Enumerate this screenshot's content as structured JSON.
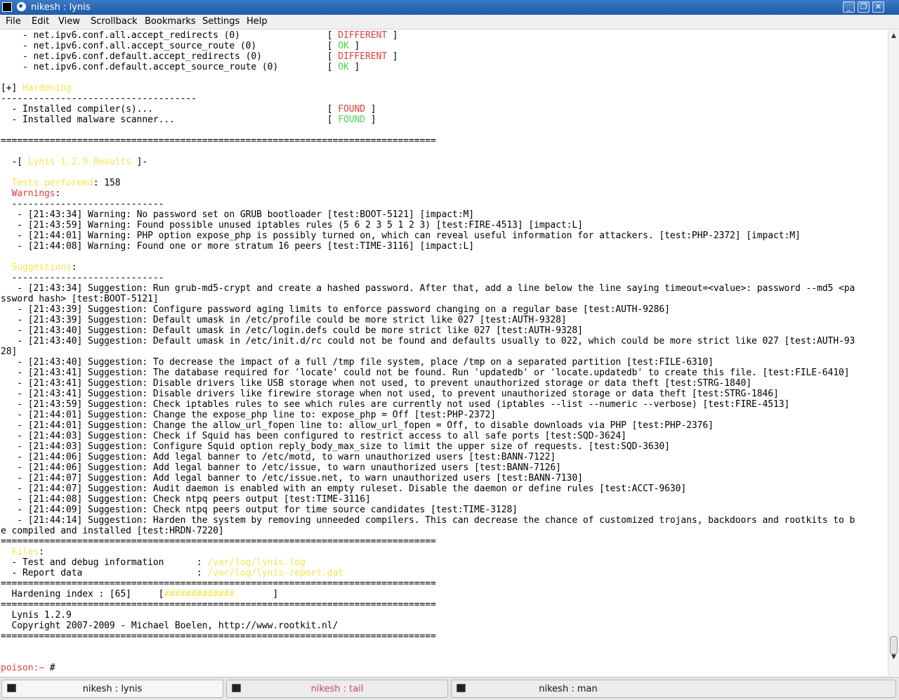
{
  "window": {
    "title": "nikesh : lynis",
    "buttons": [
      "_",
      "❐",
      "✕"
    ]
  },
  "menu": [
    "File",
    "Edit",
    "View",
    "Scrollback",
    "Bookmarks",
    "Settings",
    "Help"
  ],
  "terminal": {
    "lines": [
      [
        {
          "t": "    - net.ipv6.conf.all.accept_redirects (0)                [ "
        },
        {
          "t": "DIFFERENT",
          "c": "red"
        },
        {
          "t": " ]"
        }
      ],
      [
        {
          "t": "    - net.ipv6.conf.all.accept_source_route (0)             [ "
        },
        {
          "t": "OK",
          "c": "green"
        },
        {
          "t": " ]"
        }
      ],
      [
        {
          "t": "    - net.ipv6.conf.default.accept_redirects (0)            [ "
        },
        {
          "t": "DIFFERENT",
          "c": "red"
        },
        {
          "t": " ]"
        }
      ],
      [
        {
          "t": "    - net.ipv6.conf.default.accept_source_route (0)         [ "
        },
        {
          "t": "OK",
          "c": "green"
        },
        {
          "t": " ]"
        }
      ],
      [
        {
          "t": ""
        }
      ],
      [
        {
          "t": "[+] "
        },
        {
          "t": "Hardening",
          "c": "yellow"
        }
      ],
      [
        {
          "t": "------------------------------------"
        }
      ],
      [
        {
          "t": "  - Installed compiler(s)...                                [ "
        },
        {
          "t": "FOUND",
          "c": "red"
        },
        {
          "t": " ]"
        }
      ],
      [
        {
          "t": "  - Installed malware scanner...                            [ "
        },
        {
          "t": "FOUND",
          "c": "green"
        },
        {
          "t": " ]"
        }
      ],
      [
        {
          "t": ""
        }
      ],
      [
        {
          "t": "================================================================================"
        }
      ],
      [
        {
          "t": ""
        }
      ],
      [
        {
          "t": "  -[ "
        },
        {
          "t": "Lynis 1.2.9 Results",
          "c": "yellow"
        },
        {
          "t": " ]-"
        }
      ],
      [
        {
          "t": ""
        }
      ],
      [
        {
          "t": "  "
        },
        {
          "t": "Tests performed",
          "c": "yellow"
        },
        {
          "t": ": 158"
        }
      ],
      [
        {
          "t": "  "
        },
        {
          "t": "Warnings",
          "c": "red"
        },
        {
          "t": ":"
        }
      ],
      [
        {
          "t": "  ----------------------------"
        }
      ],
      [
        {
          "t": "   - [21:43:34] Warning: No password set on GRUB bootloader [test:BOOT-5121] [impact:M]"
        }
      ],
      [
        {
          "t": "   - [21:43:59] Warning: Found possible unused iptables rules (5 6 2 3 5 1 2 3) [test:FIRE-4513] [impact:L]"
        }
      ],
      [
        {
          "t": "   - [21:44:01] Warning: PHP option expose_php is possibly turned on, which can reveal useful information for attackers. [test:PHP-2372] [impact:M]"
        }
      ],
      [
        {
          "t": "   - [21:44:08] Warning: Found one or more stratum 16 peers [test:TIME-3116] [impact:L]"
        }
      ],
      [
        {
          "t": ""
        }
      ],
      [
        {
          "t": "  "
        },
        {
          "t": "Suggestions",
          "c": "yellow"
        },
        {
          "t": ":"
        }
      ],
      [
        {
          "t": "  ----------------------------"
        }
      ],
      [
        {
          "t": "   - [21:43:34] Suggestion: Run grub-md5-crypt and create a hashed password. After that, add a line below the line saying timeout=<value>: password --md5 <pa"
        }
      ],
      [
        {
          "t": "ssword hash> [test:BOOT-5121]"
        }
      ],
      [
        {
          "t": "   - [21:43:39] Suggestion: Configure password aging limits to enforce password changing on a regular base [test:AUTH-9286]"
        }
      ],
      [
        {
          "t": "   - [21:43:39] Suggestion: Default umask in /etc/profile could be more strict like 027 [test:AUTH-9328]"
        }
      ],
      [
        {
          "t": "   - [21:43:40] Suggestion: Default umask in /etc/login.defs could be more strict like 027 [test:AUTH-9328]"
        }
      ],
      [
        {
          "t": "   - [21:43:40] Suggestion: Default umask in /etc/init.d/rc could not be found and defaults usually to 022, which could be more strict like 027 [test:AUTH-93"
        }
      ],
      [
        {
          "t": "28]"
        }
      ],
      [
        {
          "t": "   - [21:43:40] Suggestion: To decrease the impact of a full /tmp file system, place /tmp on a separated partition [test:FILE-6310]"
        }
      ],
      [
        {
          "t": "   - [21:43:41] Suggestion: The database required for 'locate' could not be found. Run 'updatedb' or 'locate.updatedb' to create this file. [test:FILE-6410]"
        }
      ],
      [
        {
          "t": "   - [21:43:41] Suggestion: Disable drivers like USB storage when not used, to prevent unauthorized storage or data theft [test:STRG-1840]"
        }
      ],
      [
        {
          "t": "   - [21:43:41] Suggestion: Disable drivers like firewire storage when not used, to prevent unauthorized storage or data theft [test:STRG-1846]"
        }
      ],
      [
        {
          "t": "   - [21:43:59] Suggestion: Check iptables rules to see which rules are currently not used (iptables --list --numeric --verbose) [test:FIRE-4513]"
        }
      ],
      [
        {
          "t": "   - [21:44:01] Suggestion: Change the expose_php line to: expose_php = Off [test:PHP-2372]"
        }
      ],
      [
        {
          "t": "   - [21:44:01] Suggestion: Change the allow_url_fopen line to: allow_url_fopen = Off, to disable downloads via PHP [test:PHP-2376]"
        }
      ],
      [
        {
          "t": "   - [21:44:03] Suggestion: Check if Squid has been configured to restrict access to all safe ports [test:SQD-3624]"
        }
      ],
      [
        {
          "t": "   - [21:44:03] Suggestion: Configure Squid option reply_body_max_size to limit the upper size of requests. [test:SQD-3630]"
        }
      ],
      [
        {
          "t": "   - [21:44:06] Suggestion: Add legal banner to /etc/motd, to warn unauthorized users [test:BANN-7122]"
        }
      ],
      [
        {
          "t": "   - [21:44:06] Suggestion: Add legal banner to /etc/issue, to warn unauthorized users [test:BANN-7126]"
        }
      ],
      [
        {
          "t": "   - [21:44:07] Suggestion: Add legal banner to /etc/issue.net, to warn unauthorized users [test:BANN-7130]"
        }
      ],
      [
        {
          "t": "   - [21:44:07] Suggestion: Audit daemon is enabled with an empty ruleset. Disable the daemon or define rules [test:ACCT-9630]"
        }
      ],
      [
        {
          "t": "   - [21:44:08] Suggestion: Check ntpq peers output [test:TIME-3116]"
        }
      ],
      [
        {
          "t": "   - [21:44:09] Suggestion: Check ntpq peers output for time source candidates [test:TIME-3128]"
        }
      ],
      [
        {
          "t": "   - [21:44:14] Suggestion: Harden the system by removing unneeded compilers. This can decrease the chance of customized trojans, backdoors and rootkits to b"
        }
      ],
      [
        {
          "t": "e compiled and installed [test:HRDN-7220]"
        }
      ],
      [
        {
          "t": "================================================================================"
        }
      ],
      [
        {
          "t": "  "
        },
        {
          "t": "Files",
          "c": "yellow"
        },
        {
          "t": ":"
        }
      ],
      [
        {
          "t": "  - Test and debug information      : "
        },
        {
          "t": "/var/log/lynis.log",
          "c": "yellow"
        }
      ],
      [
        {
          "t": "  - Report data                     : "
        },
        {
          "t": "/var/log/lynis-report.dat",
          "c": "yellow"
        }
      ],
      [
        {
          "t": "================================================================================"
        }
      ],
      [
        {
          "t": "  Hardening index : [65]     ["
        },
        {
          "t": "#############",
          "c": "yellow"
        },
        {
          "t": "       ]"
        }
      ],
      [
        {
          "t": "================================================================================"
        }
      ],
      [
        {
          "t": "  Lynis 1.2.9"
        }
      ],
      [
        {
          "t": "  Copyright 2007-2009 - Michael Boelen, http://www.rootkit.nl/"
        }
      ],
      [
        {
          "t": "================================================================================"
        }
      ],
      [
        {
          "t": ""
        }
      ],
      [
        {
          "t": ""
        }
      ],
      [
        {
          "t": "poison:~ ",
          "c": "red"
        },
        {
          "t": "#"
        }
      ]
    ]
  },
  "scrollbar": {
    "up": "▲",
    "down": "▼",
    "position": 0.96
  },
  "tabs": [
    {
      "label": "nikesh : lynis",
      "active": true
    },
    {
      "label": "nikesh : tail",
      "active": false,
      "highlight": true
    },
    {
      "label": "nikesh : man",
      "active": false
    }
  ]
}
